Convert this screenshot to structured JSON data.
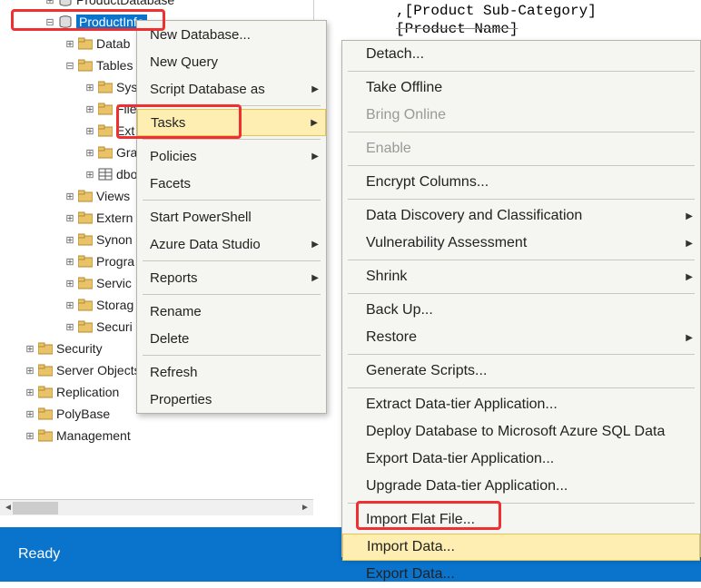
{
  "tree": {
    "selected_db": "ProductInfo",
    "items_top": [
      {
        "indent": 2,
        "exp": "-",
        "icon": "db",
        "label": "ProductDatabase",
        "cut": true
      },
      {
        "indent": 2,
        "exp": "-",
        "icon": "db",
        "label": "ProductInfo",
        "selected": true
      }
    ],
    "items_mid": [
      {
        "indent": 3,
        "exp": "+",
        "icon": "folder",
        "label": "Datab"
      },
      {
        "indent": 3,
        "exp": "-",
        "icon": "folder",
        "label": "Tables"
      },
      {
        "indent": 4,
        "exp": "+",
        "icon": "folder",
        "label": "Syst"
      },
      {
        "indent": 4,
        "exp": "+",
        "icon": "folder",
        "label": "File"
      },
      {
        "indent": 4,
        "exp": "+",
        "icon": "folder",
        "label": "Ext"
      },
      {
        "indent": 4,
        "exp": "+",
        "icon": "folder",
        "label": "Grap"
      },
      {
        "indent": 4,
        "exp": "+",
        "icon": "table",
        "label": "dbo"
      },
      {
        "indent": 3,
        "exp": "+",
        "icon": "folder",
        "label": "Views"
      },
      {
        "indent": 3,
        "exp": "+",
        "icon": "folder",
        "label": "Extern"
      },
      {
        "indent": 3,
        "exp": "+",
        "icon": "folder",
        "label": "Synon"
      },
      {
        "indent": 3,
        "exp": "+",
        "icon": "folder",
        "label": "Progra"
      },
      {
        "indent": 3,
        "exp": "+",
        "icon": "folder",
        "label": "Servic"
      },
      {
        "indent": 3,
        "exp": "+",
        "icon": "folder",
        "label": "Storag"
      },
      {
        "indent": 3,
        "exp": "+",
        "icon": "folder",
        "label": "Securi"
      }
    ],
    "items_bottom": [
      {
        "indent": 1,
        "exp": "+",
        "icon": "folder",
        "label": "Security"
      },
      {
        "indent": 1,
        "exp": "+",
        "icon": "folder",
        "label": "Server Objects"
      },
      {
        "indent": 1,
        "exp": "+",
        "icon": "folder",
        "label": "Replication"
      },
      {
        "indent": 1,
        "exp": "+",
        "icon": "folder",
        "label": "PolyBase"
      },
      {
        "indent": 1,
        "exp": "+",
        "icon": "folder",
        "label": "Management"
      }
    ]
  },
  "code": {
    "line1": ",[Product Sub-Category]",
    "line2": "[Product Name]"
  },
  "menu1": [
    {
      "label": "New Database...",
      "sub": false
    },
    {
      "label": "New Query",
      "sub": false
    },
    {
      "label": "Script Database as",
      "sub": true
    },
    {
      "sep": true
    },
    {
      "label": "Tasks",
      "sub": true,
      "hover": true
    },
    {
      "sep": true
    },
    {
      "label": "Policies",
      "sub": true
    },
    {
      "label": "Facets",
      "sub": false
    },
    {
      "sep": true
    },
    {
      "label": "Start PowerShell",
      "sub": false
    },
    {
      "label": "Azure Data Studio",
      "sub": true
    },
    {
      "sep": true
    },
    {
      "label": "Reports",
      "sub": true
    },
    {
      "sep": true
    },
    {
      "label": "Rename",
      "sub": false
    },
    {
      "label": "Delete",
      "sub": false
    },
    {
      "sep": true
    },
    {
      "label": "Refresh",
      "sub": false
    },
    {
      "label": "Properties",
      "sub": false
    }
  ],
  "menu2": [
    {
      "label": "Detach...",
      "sub": false
    },
    {
      "sep": true
    },
    {
      "label": "Take Offline",
      "sub": false
    },
    {
      "label": "Bring Online",
      "sub": false,
      "disabled": true
    },
    {
      "sep": true
    },
    {
      "label": "Enable",
      "sub": false,
      "disabled": true
    },
    {
      "sep": true
    },
    {
      "label": "Encrypt Columns...",
      "sub": false
    },
    {
      "sep": true
    },
    {
      "label": "Data Discovery and Classification",
      "sub": true
    },
    {
      "label": "Vulnerability Assessment",
      "sub": true
    },
    {
      "sep": true
    },
    {
      "label": "Shrink",
      "sub": true
    },
    {
      "sep": true
    },
    {
      "label": "Back Up...",
      "sub": false
    },
    {
      "label": "Restore",
      "sub": true
    },
    {
      "sep": true
    },
    {
      "label": "Generate Scripts...",
      "sub": false
    },
    {
      "sep": true
    },
    {
      "label": "Extract Data-tier Application...",
      "sub": false
    },
    {
      "label": "Deploy Database to Microsoft Azure SQL Data",
      "sub": false,
      "cut": true
    },
    {
      "label": "Export Data-tier Application...",
      "sub": false
    },
    {
      "label": "Upgrade Data-tier Application...",
      "sub": false
    },
    {
      "sep": true
    },
    {
      "label": "Import Flat File...",
      "sub": false
    },
    {
      "label": "Import Data...",
      "sub": false,
      "hover": true
    },
    {
      "label": "Export Data...",
      "sub": false
    }
  ],
  "status": "Ready",
  "icons": {
    "sub_arrow": "▶"
  }
}
